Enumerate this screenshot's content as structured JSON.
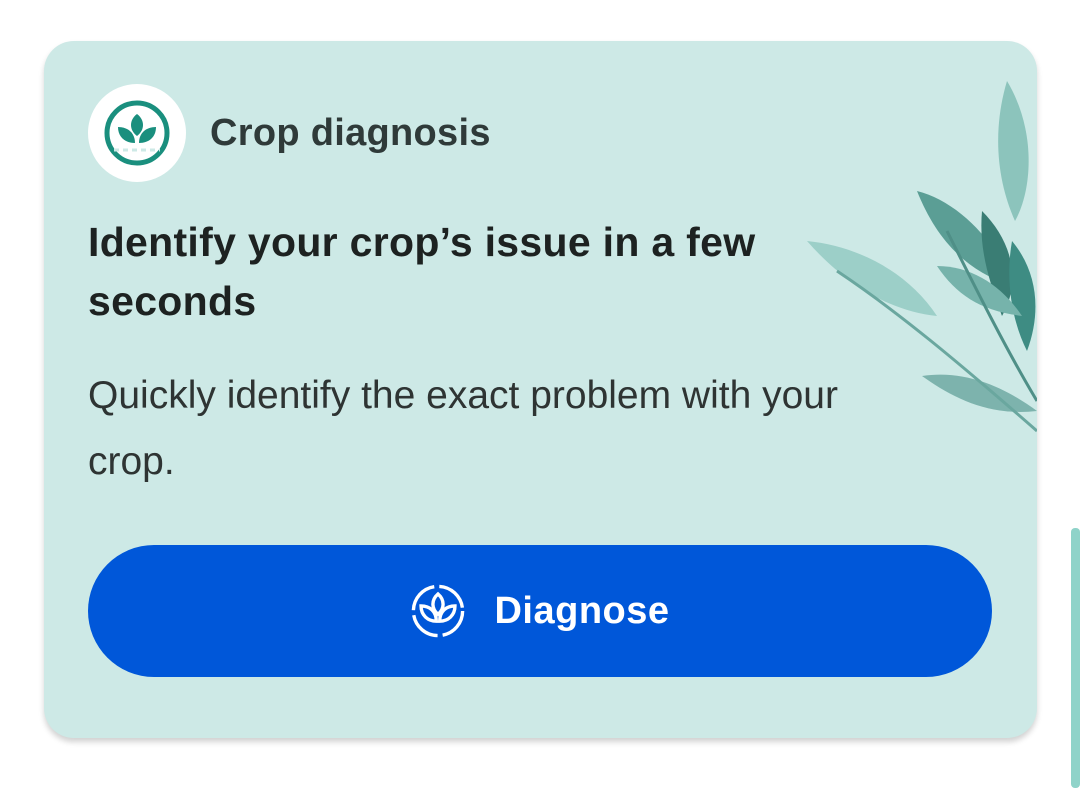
{
  "card": {
    "title": "Crop diagnosis",
    "headline": "Identify your crop’s issue in a few seconds",
    "description": "Quickly identify the exact problem with your crop.",
    "button_label": "Diagnose"
  },
  "icons": {
    "logo": "plant-diagnosis-icon",
    "button": "plant-diagnosis-icon",
    "decoration": "leaves-illustration"
  },
  "colors": {
    "card_background": "#cde9e6",
    "button_background": "#0057d9",
    "brand_teal": "#1a8f7e"
  }
}
